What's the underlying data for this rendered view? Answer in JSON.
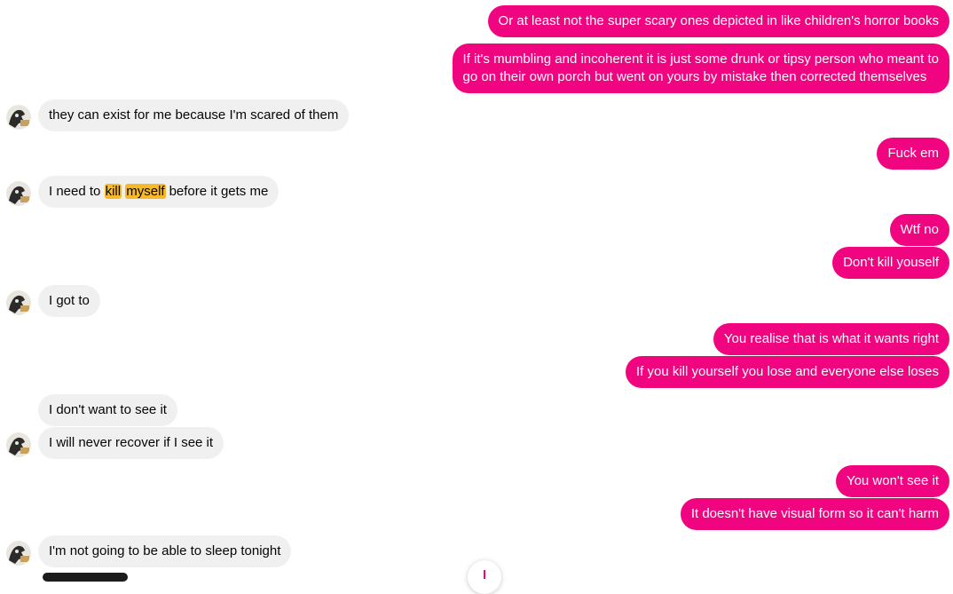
{
  "contact": {
    "avatar_icon": "contact-avatar-icon"
  },
  "colors": {
    "outgoing": "#f0047f",
    "incoming": "#f0f0f0",
    "highlight": "#f7b928"
  },
  "messages": [
    {
      "side": "out",
      "text": "Or at least not the super scary ones depicted in like children's horror books"
    },
    {
      "side": "out",
      "line1": "If it's mumbling and incoherent it is just some drunk or tipsy person who meant to",
      "line2": "go on their own porch but went on yours by mistake then corrected themselves"
    },
    {
      "side": "in",
      "text": "they can exist for me because I'm scared of them"
    },
    {
      "side": "out",
      "text": "Fuck em"
    },
    {
      "side": "in",
      "pre": "I need to",
      "hl1": "kill",
      "hl2": "myself",
      "post": "before it gets me"
    },
    {
      "side": "out",
      "text": "Wtf no"
    },
    {
      "side": "out",
      "text": "Don't kill youself"
    },
    {
      "side": "in",
      "text": "I got to"
    },
    {
      "side": "out",
      "text": "You realise that is what it wants right"
    },
    {
      "side": "out",
      "text": "If you kill yourself you lose and everyone else loses"
    },
    {
      "side": "in",
      "text": "I don't want to see it"
    },
    {
      "side": "in",
      "text": "I will never recover if I see it"
    },
    {
      "side": "out",
      "text": "You won't see it"
    },
    {
      "side": "out",
      "text": "It doesn't have visual form so it can't harm"
    },
    {
      "side": "in",
      "text": "I'm not going to be able to sleep tonight"
    }
  ],
  "scroll_button": {
    "icon": "arrow-down-icon"
  }
}
